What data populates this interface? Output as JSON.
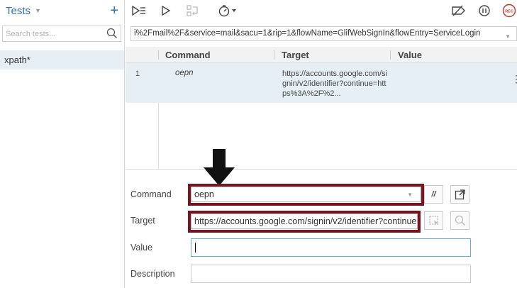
{
  "sidebar": {
    "title": "Tests",
    "search_placeholder": "Search tests...",
    "items": [
      {
        "label": "xpath*"
      }
    ]
  },
  "toolbar": {
    "icons": [
      "run-all-icon",
      "run-icon",
      "step-icon",
      "speed-timer-icon",
      "disable-breakpoints-icon",
      "pause-icon",
      "record-icon"
    ],
    "record_label": "REC"
  },
  "url": {
    "value": "i%2Fmail%2F&service=mail&sacu=1&rip=1&flowName=GlifWebSignIn&flowEntry=ServiceLogin"
  },
  "table": {
    "headers": [
      "Command",
      "Target",
      "Value"
    ],
    "rows": [
      {
        "index": "1",
        "command": "oepn",
        "target": "https://accounts.google.com/signin/v2/identifier?continue=https%3A%2F%2...",
        "value": ""
      }
    ]
  },
  "editor": {
    "command_label": "Command",
    "command_value": "oepn",
    "target_label": "Target",
    "target_value": "https://accounts.google.com/signin/v2/identifier?continue",
    "value_label": "Value",
    "value_value": "",
    "description_label": "Description",
    "description_value": "",
    "comment_button": "//"
  },
  "colors": {
    "accent": "#2f6fb7",
    "highlight_border": "#7a1320",
    "selected_row": "#e6eef6",
    "focus_border": "#66b2c6"
  }
}
